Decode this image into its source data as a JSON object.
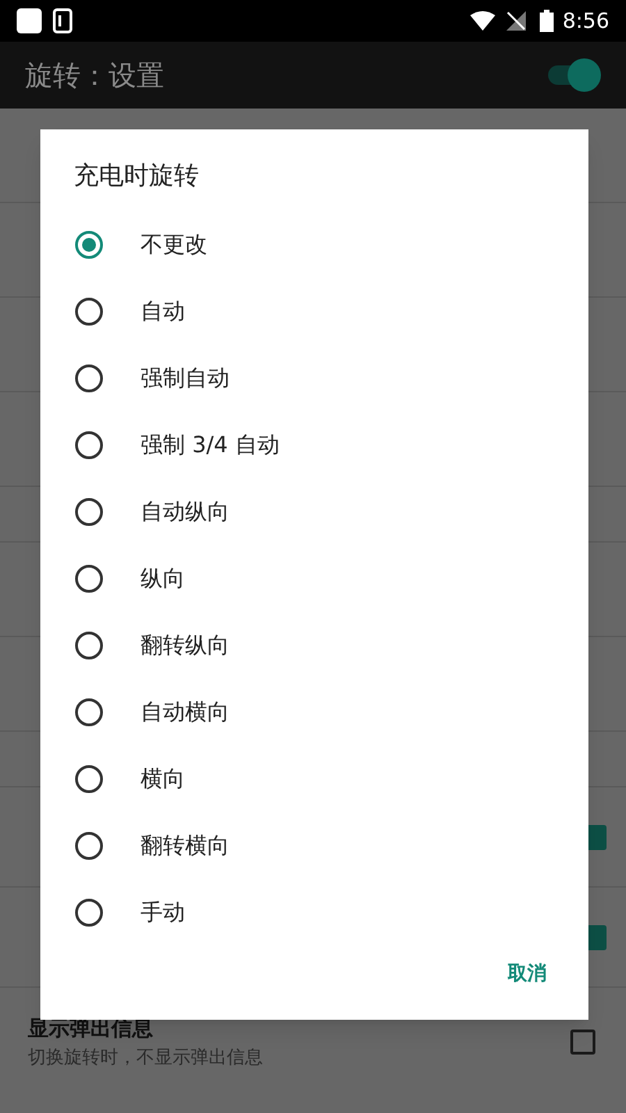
{
  "status_bar": {
    "time": "8:56"
  },
  "toolbar": {
    "title": "旋转：设置",
    "switch_on": true
  },
  "background_rows": [
    {
      "kind": "item"
    },
    {
      "kind": "item"
    },
    {
      "kind": "item"
    },
    {
      "kind": "item"
    },
    {
      "kind": "header"
    },
    {
      "kind": "item"
    },
    {
      "kind": "item"
    },
    {
      "kind": "header"
    },
    {
      "kind": "checkbox",
      "checked": true
    },
    {
      "kind": "checkbox",
      "checked": true
    }
  ],
  "last_row": {
    "title": "显示弹出信息",
    "subtitle": "切换旋转时，不显示弹出信息",
    "checked": false
  },
  "dialog": {
    "title": "充电时旋转",
    "options": [
      {
        "label": "不更改",
        "selected": true
      },
      {
        "label": "自动",
        "selected": false
      },
      {
        "label": "强制自动",
        "selected": false
      },
      {
        "label": "强制 3/4 自动",
        "selected": false
      },
      {
        "label": "自动纵向",
        "selected": false
      },
      {
        "label": "纵向",
        "selected": false
      },
      {
        "label": "翻转纵向",
        "selected": false
      },
      {
        "label": "自动横向",
        "selected": false
      },
      {
        "label": "横向",
        "selected": false
      },
      {
        "label": "翻转横向",
        "selected": false
      },
      {
        "label": "手动",
        "selected": false
      }
    ],
    "cancel": "取消"
  }
}
